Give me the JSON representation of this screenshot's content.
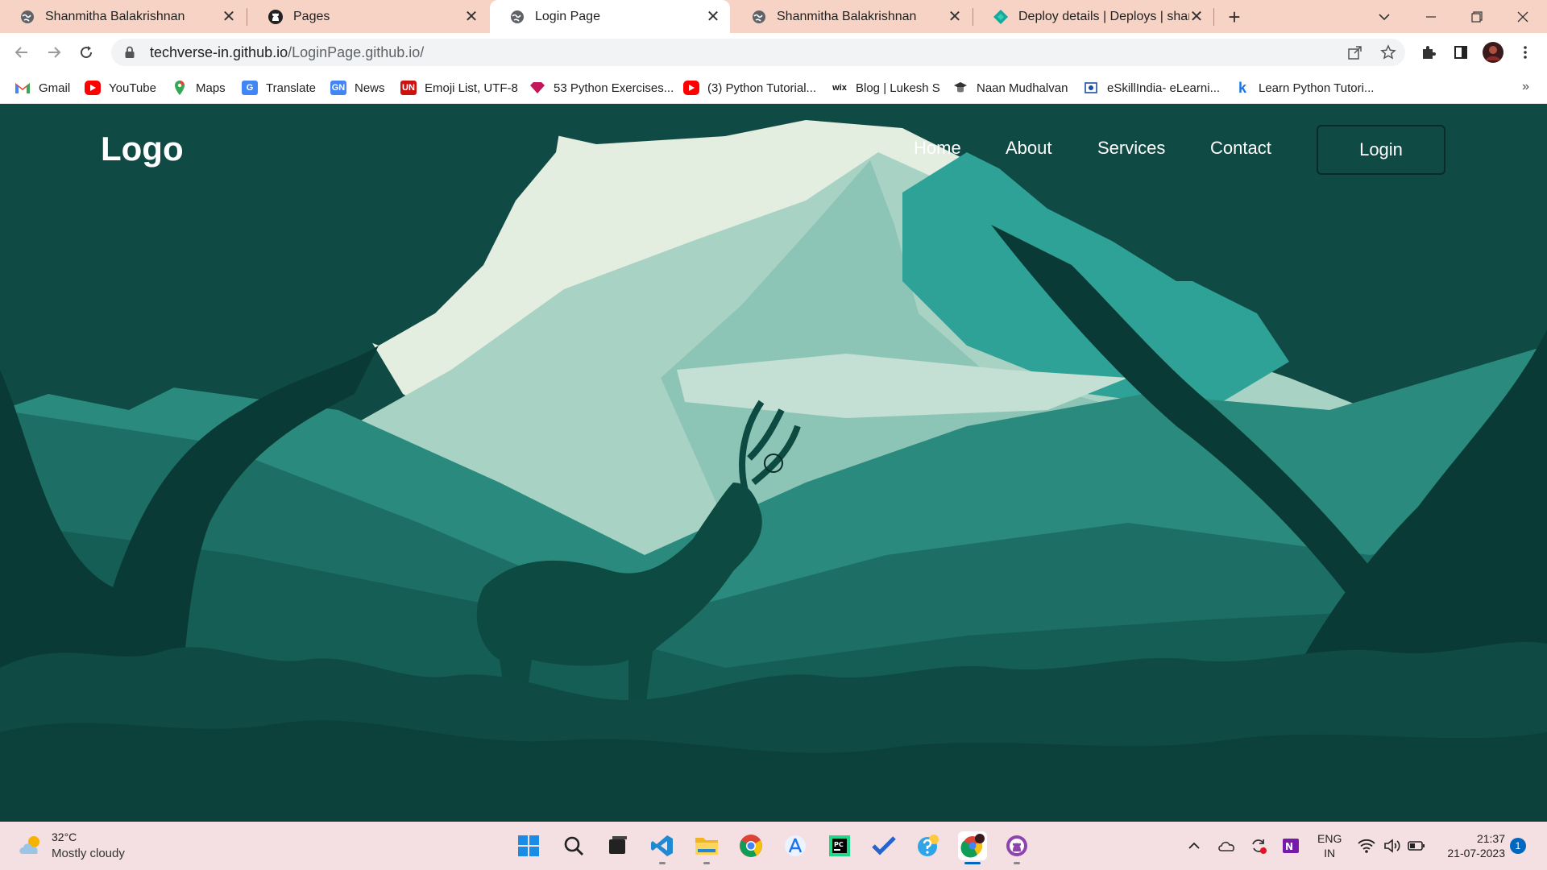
{
  "browser": {
    "tabs": [
      {
        "title": "Shanmitha Balakrishnan",
        "icon": "globe-icon"
      },
      {
        "title": "Pages",
        "icon": "github-icon"
      },
      {
        "title": "Login Page",
        "icon": "globe-icon",
        "active": true
      },
      {
        "title": "Shanmitha Balakrishnan",
        "icon": "globe-icon"
      },
      {
        "title": "Deploy details | Deploys | shanmi",
        "icon": "netlify-icon"
      }
    ],
    "new_tab_label": "+",
    "url_host": "techverse-in.github.io",
    "url_path": "/LoginPage.github.io/",
    "bookmarks": [
      {
        "label": "Gmail",
        "icon": "gmail-icon"
      },
      {
        "label": "YouTube",
        "icon": "youtube-icon"
      },
      {
        "label": "Maps",
        "icon": "maps-icon"
      },
      {
        "label": "Translate",
        "icon": "translate-icon"
      },
      {
        "label": "News",
        "icon": "news-icon"
      },
      {
        "label": "Emoji List, UTF-8",
        "icon": "unicode-icon"
      },
      {
        "label": "53 Python Exercises...",
        "icon": "gem-icon"
      },
      {
        "label": "(3) Python Tutorial...",
        "icon": "youtube-icon"
      },
      {
        "label": "Blog | Lukesh S",
        "icon": "wix-icon"
      },
      {
        "label": "Naan Mudhalvan",
        "icon": "graduate-icon"
      },
      {
        "label": "eSkillIndia- eLearni...",
        "icon": "eskill-icon"
      },
      {
        "label": "Learn Python Tutori...",
        "icon": "k-icon"
      }
    ],
    "bookmarks_more": "»"
  },
  "site": {
    "logo": "Logo",
    "nav": [
      "Home",
      "About",
      "Services",
      "Contact"
    ],
    "login_label": "Login"
  },
  "taskbar": {
    "weather_temp": "32°C",
    "weather_desc": "Mostly cloudy",
    "lang_top": "ENG",
    "lang_bottom": "IN",
    "time": "21:37",
    "date": "21-07-2023",
    "notifications": "1",
    "apps": [
      "windows-start-icon",
      "search-icon",
      "task-view-icon",
      "vscode-icon",
      "file-explorer-icon",
      "chrome-icon",
      "app-store-icon",
      "pycharm-icon",
      "todo-icon",
      "photos-icon",
      "chrome-profile-icon",
      "github-desktop-icon"
    ]
  },
  "colors": {
    "tab_strip": "#f6d3c4",
    "page_bg": "#0f4a44",
    "taskbar": "#f4dfe3"
  }
}
